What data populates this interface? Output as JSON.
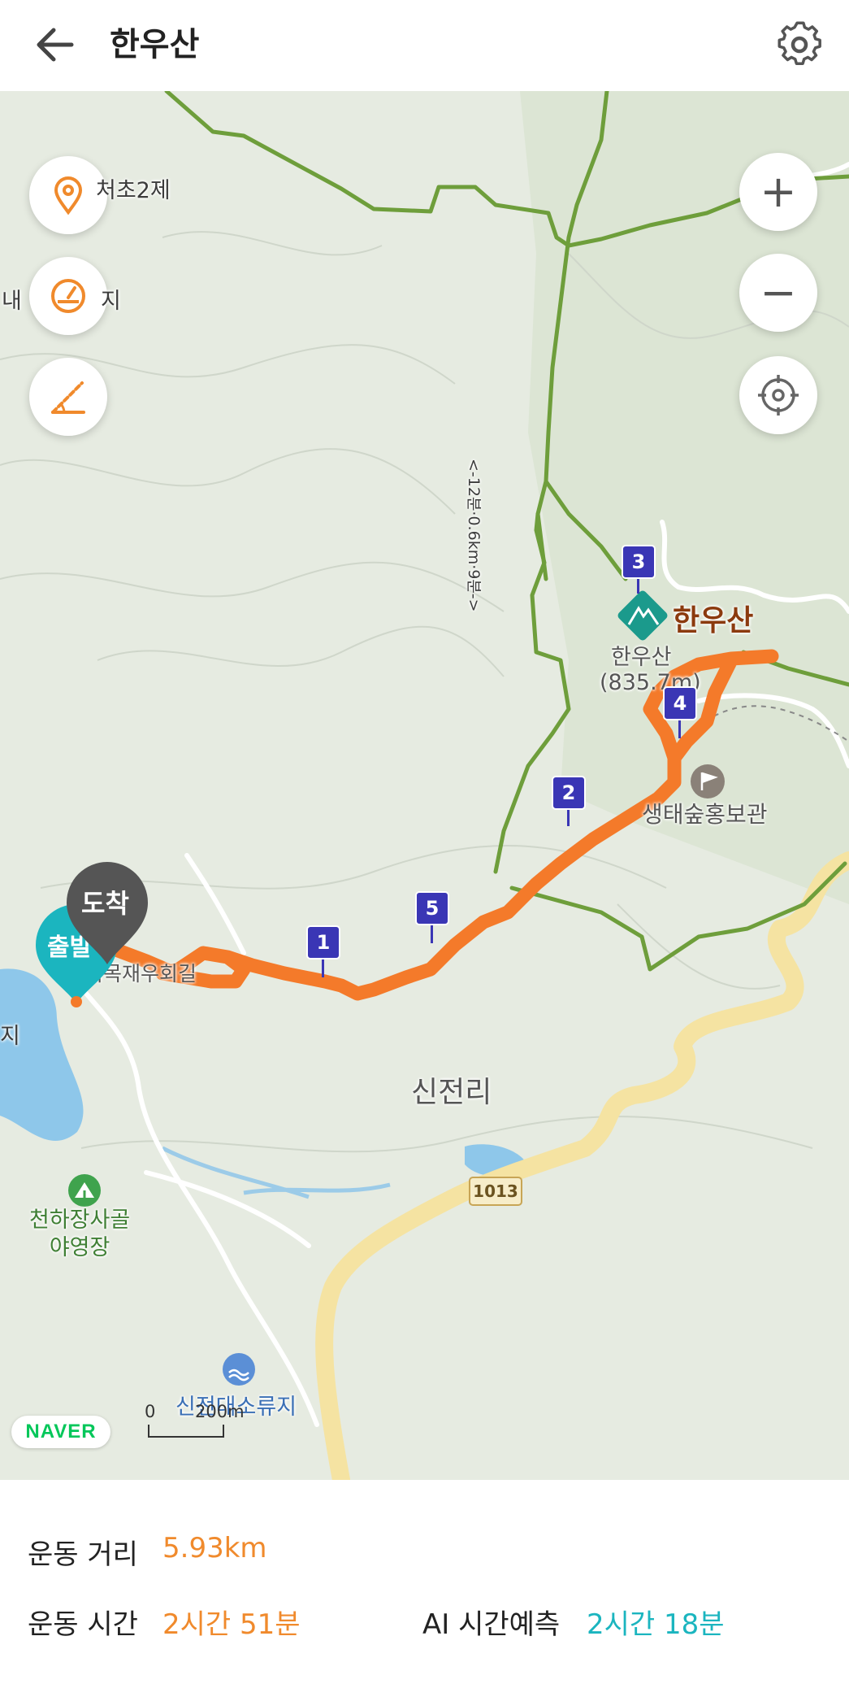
{
  "header": {
    "title": "한우산",
    "back_icon": "arrow-left-icon",
    "settings_icon": "gear-icon"
  },
  "map": {
    "controls": {
      "location_icon": "map-pin-icon",
      "speed_icon": "speedometer-icon",
      "elevation_icon": "elevation-slope-icon",
      "zoom_in": "+",
      "zoom_out": "−",
      "recenter_icon": "crosshair-icon"
    },
    "labels": {
      "place_top_left": "처초2제",
      "place_left": "내",
      "place_left_2": "지",
      "peak_name": "한우산",
      "peak_small": "한우산",
      "peak_elevation": "(835.7m)",
      "eco_hall": "생태숲홍보관",
      "village": "신전리",
      "road_number": "1013",
      "campground": "천하장사골\n야영장",
      "reservoir": "신전대소류지",
      "left_edge": "지",
      "trail_distance": "<-12분·0.6km·9분->",
      "start_building": "쇠목재우회길"
    },
    "markers": {
      "start": "출발",
      "arrival": "도착",
      "waypoints": [
        "1",
        "2",
        "3",
        "4",
        "5"
      ]
    },
    "attribution": "NAVER",
    "scale": {
      "zero": "0",
      "distance": "200m"
    },
    "colors": {
      "route": "#f47a2a",
      "trail": "#6e9e3b",
      "road": "#f5e3a2",
      "water": "#8ec7ea",
      "start_marker": "#1bb5bf",
      "arrival_marker": "#555555",
      "waypoint": "#3a36b5"
    }
  },
  "stats": {
    "distance_label": "운동 거리",
    "distance_value": "5.93km",
    "time_label": "운동 시간",
    "time_value": "2시간 51분",
    "ai_label": "AI 시간예측",
    "ai_value": "2시간 18분"
  }
}
